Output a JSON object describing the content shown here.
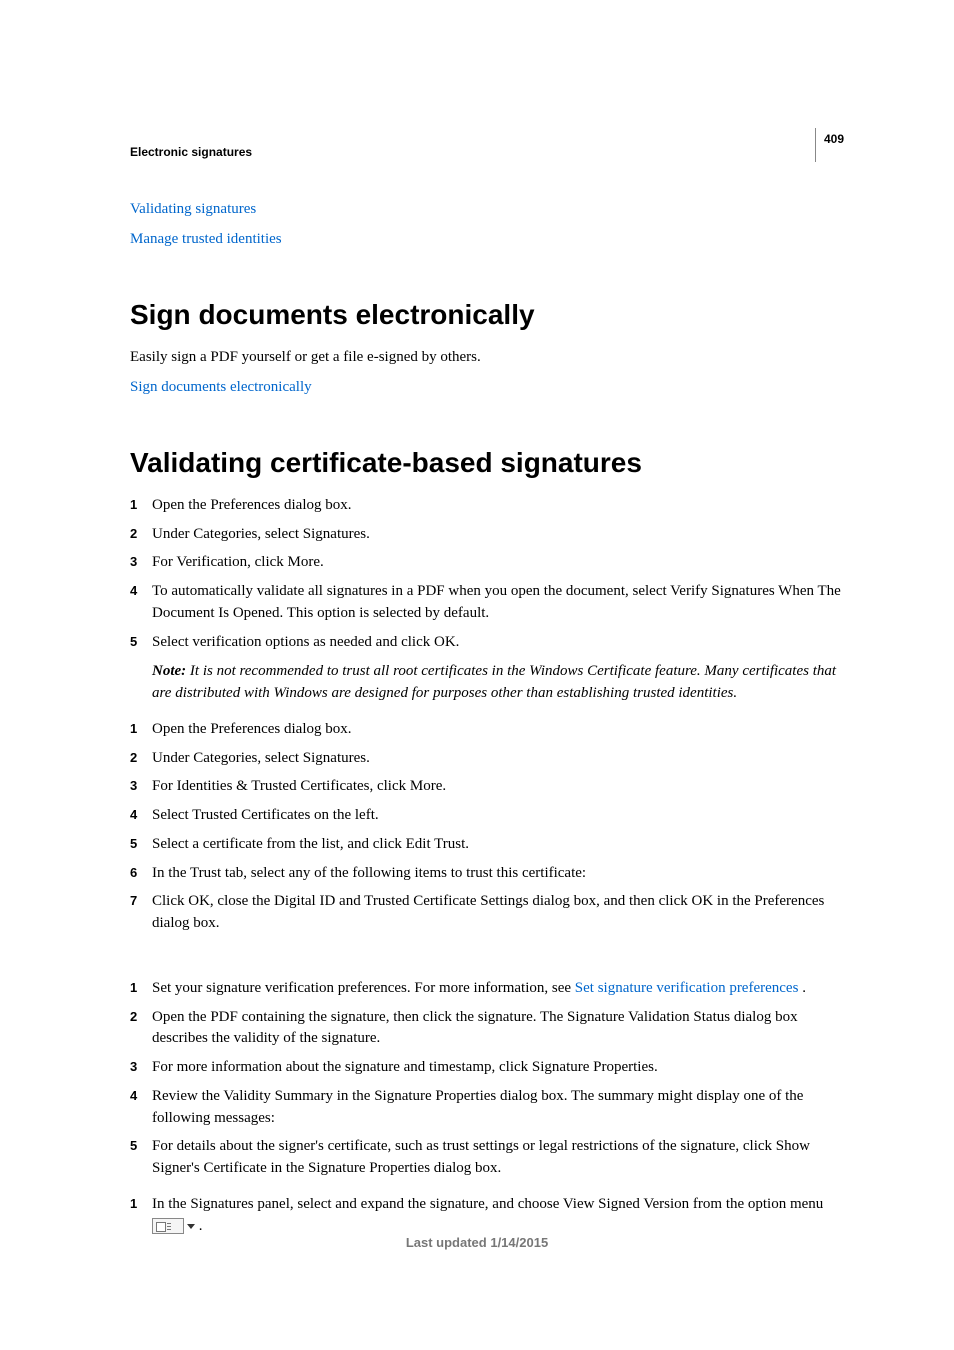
{
  "pageNumber": "409",
  "chapter": "Electronic signatures",
  "topLinks": [
    "Validating signatures",
    "Manage trusted identities"
  ],
  "section1": {
    "heading": "Sign documents electronically",
    "intro": "Easily sign a PDF yourself or get a file e-signed by others.",
    "link": "Sign documents electronically"
  },
  "section2": {
    "heading": "Validating certificate-based signatures",
    "list1": [
      "Open the Preferences dialog box.",
      "Under Categories, select Signatures.",
      "For Verification, click More.",
      "To automatically validate all signatures in a PDF when you open the document, select Verify Signatures When The Document Is Opened. This option is selected by default.",
      "Select verification options as needed and click OK."
    ],
    "noteLabel": "Note:",
    "noteText": " It is not recommended to trust all root certificates in the Windows Certificate feature. Many certificates that are distributed with Windows are designed for purposes other than establishing trusted identities.",
    "list2": [
      "Open the Preferences dialog box.",
      "Under Categories, select Signatures.",
      "For Identities & Trusted Certificates, click More.",
      "Select Trusted Certificates on the left.",
      "Select a certificate from the list, and click Edit Trust.",
      "In the Trust tab, select any of the following items to trust this certificate:",
      "Click OK, close the Digital ID and Trusted Certificate Settings dialog box, and then click OK in the Preferences dialog box."
    ],
    "list3": [
      {
        "pre": "Set your signature verification preferences. For more information, see ",
        "link": "Set signature verification preferences",
        "post": " ."
      },
      {
        "pre": "Open the PDF containing the signature, then click the signature. The Signature Validation Status dialog box describes the validity of the signature."
      },
      {
        "pre": "For more information about the signature and timestamp, click Signature Properties."
      },
      {
        "pre": "Review the Validity Summary in the Signature Properties dialog box. The summary might display one of the following messages:"
      },
      {
        "pre": "For details about the signer's certificate, such as trust settings or legal restrictions of the signature, click Show Signer's Certificate in the Signature Properties dialog box."
      }
    ],
    "list4": [
      "In the Signatures panel, select and expand the signature, and choose View Signed Version from the option menu "
    ]
  },
  "footer": "Last updated 1/14/2015"
}
